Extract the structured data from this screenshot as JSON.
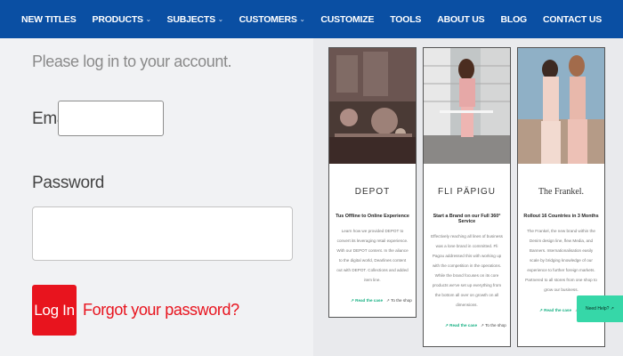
{
  "nav": {
    "items": [
      {
        "label": "NEW TITLES"
      },
      {
        "label": "PRODUCTS",
        "caret": "⌄"
      },
      {
        "label": "SUBJECTS",
        "caret": "⌄"
      },
      {
        "label": "CUSTOMERS",
        "caret": "⌄"
      },
      {
        "label": "CUSTOMIZE"
      },
      {
        "label": "TOOLS"
      },
      {
        "label": "ABOUT US"
      },
      {
        "label": "BLOG"
      },
      {
        "label": "CONTACT US"
      }
    ]
  },
  "login": {
    "prompt": "Please log in to your account.",
    "email_label": "Email",
    "email_value": "",
    "password_label": "Password",
    "password_value": "",
    "login_button": "Log In",
    "forgot_link": "Forgot your password?"
  },
  "cards": [
    {
      "brand": "DEPOT",
      "headline": "Tus Offline to Online Experience",
      "body": "Learn how we provided DEPOT to convert its leveraging retail experience. With our DEPOT content. In the aliance to the digital world, Dearlines content out with DEPOT. Collections and added item line.",
      "read_link": "↗ Read the case",
      "study_link": "↗ To the shop"
    },
    {
      "brand": "FLI PÄPIGU",
      "headline": "Start a Brand on our Full 360° Service",
      "body": "Effectively reaching all lines of business was a lone brand in committed. Fli Pagou addressed this with working up with the competition in the operations. While the brand focuses on its core products we've set up everything from the bottom all over on growth on all dimensions.",
      "read_link": "↗ Read the case",
      "study_link": "↗ To the shop"
    },
    {
      "brand": "The Frankel.",
      "headline": "Rollout 16 Countries in 3 Months",
      "body": "The Frankel, the new brand within the Denim design line, flew Media, and Banners. Internationalisation easily scale by bridging knowledge of our experience to further foreign markets. Partnered to all stores from one shop to grow our business.",
      "read_link": "↗ Read the case",
      "study_link": "↗ To the shop"
    }
  ],
  "help_button": "Need Help? ↗",
  "colors": {
    "nav_bg": "#0a4fa3",
    "primary_red": "#e8141e",
    "accent_green": "#18b184",
    "help_bg": "#36d7a8"
  }
}
